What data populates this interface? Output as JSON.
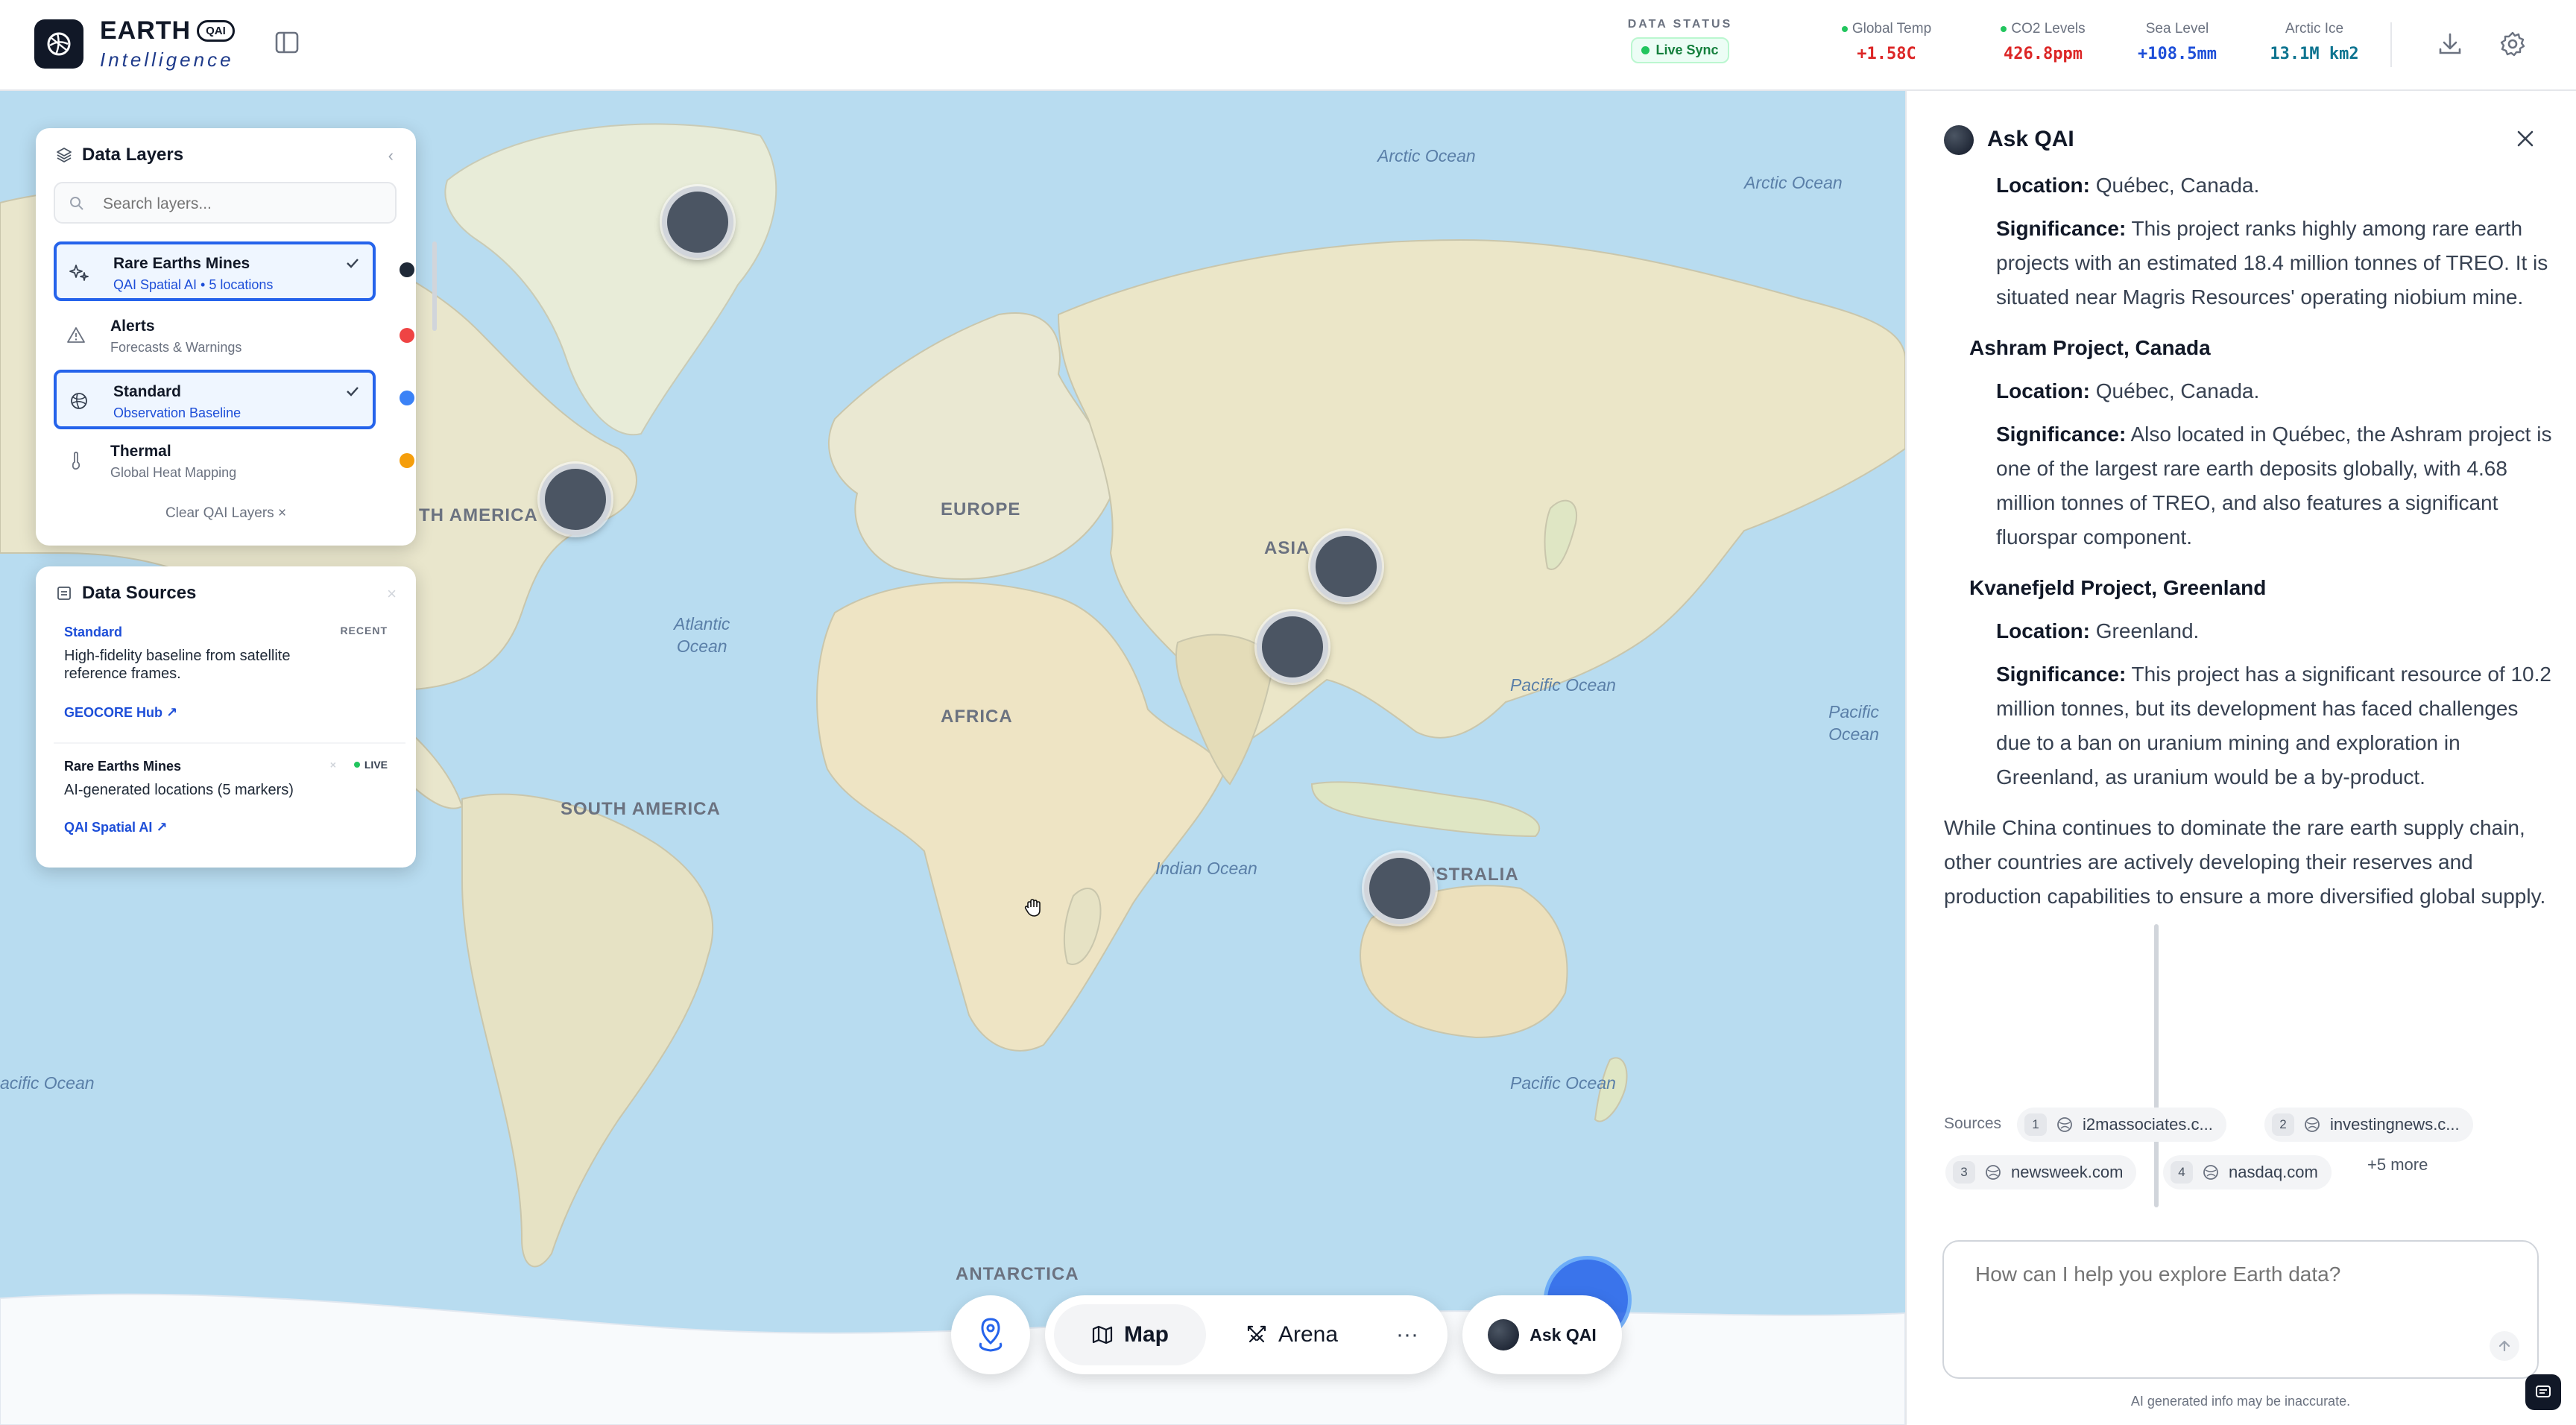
{
  "brand": {
    "name": "EARTH",
    "badge": "QAI",
    "subtitle": "Intelligence"
  },
  "header": {
    "data_status_label": "DATA STATUS",
    "live_sync": "Live Sync",
    "metrics": [
      {
        "label": "Global Temp",
        "value": "+1.58C",
        "color": "#dc2626",
        "has_dot": true
      },
      {
        "label": "CO2 Levels",
        "value": "426.8ppm",
        "color": "#dc2626",
        "has_dot": true
      },
      {
        "label": "Sea Level",
        "value": "+108.5mm",
        "color": "#1d4ed8",
        "has_dot": false
      },
      {
        "label": "Arctic Ice",
        "value": "13.1M km2",
        "color": "#0e7490",
        "has_dot": false
      }
    ]
  },
  "map": {
    "labels": {
      "north_america": "TH AMERICA",
      "europe": "EUROPE",
      "asia": "ASIA",
      "africa": "AFRICA",
      "south_america": "SOUTH AMERICA",
      "australia": "AUSTRALIA",
      "antarctica": "ANTARCTICA"
    },
    "oceans": {
      "arctic_1": "Arctic Ocean",
      "arctic_2": "Arctic Ocean",
      "atlantic_1": "Atlantic",
      "atlantic_2": "Ocean",
      "pacific_1": "Pacific Ocean",
      "pacific_2": "Pacific Ocean",
      "indian": "Indian Ocean",
      "pacific_3": "Pacific Ocean",
      "pacific_4": "acific Ocean"
    }
  },
  "layers_panel": {
    "title": "Data Layers",
    "search_placeholder": "Search layers...",
    "clear_label": "Clear QAI Layers",
    "items": [
      {
        "name": "Rare Earths Mines",
        "sub": "QAI Spatial AI • 5 locations",
        "selected": true,
        "dot": "#1f2937"
      },
      {
        "name": "Alerts",
        "sub": "Forecasts & Warnings",
        "selected": false,
        "dot": "#ef4444"
      },
      {
        "name": "Standard",
        "sub": "Observation Baseline",
        "selected": true,
        "dot": "#3b82f6"
      },
      {
        "name": "Thermal",
        "sub": "Global Heat Mapping",
        "selected": false,
        "dot": "#f59e0b"
      }
    ]
  },
  "sources_panel": {
    "title": "Data Sources",
    "cards": [
      {
        "name": "Standard",
        "tag": "RECENT",
        "desc": "High-fidelity baseline from satellite reference frames.",
        "link": "GEOCORE Hub"
      },
      {
        "name": "Rare Earths Mines",
        "tag": "LIVE",
        "desc": "AI-generated locations (5 markers)",
        "link": "QAI Spatial AI"
      }
    ]
  },
  "toolbar": {
    "map": "Map",
    "arena": "Arena",
    "more": "···",
    "ask": "Ask QAI"
  },
  "chat": {
    "title": "Ask QAI",
    "location_label": "Location:",
    "significance_label": "Significance:",
    "p1_location": "Québec, Canada.",
    "p1_significance": "This project ranks highly among rare earth projects with an estimated 18.4 million tonnes of TREO. It is situated near Magris Resources' operating niobium mine.",
    "h2": "Ashram Project, Canada",
    "p2_location": "Québec, Canada.",
    "p2_significance": "Also located in Québec, the Ashram project is one of the largest rare earth deposits globally, with 4.68 million tonnes of TREO, and also features a significant fluorspar component.",
    "h3": "Kvanefjeld Project, Greenland",
    "p3_location": "Greenland.",
    "p3_significance": "This project has a significant resource of 10.2 million tonnes, but its development has faced challenges due to a ban on uranium mining and exploration in Greenland, as uranium would be a by-product.",
    "summary": "While China continues to dominate the rare earth supply chain, other countries are actively developing their reserves and production capabilities to ensure a more diversified global supply.",
    "sources_label": "Sources",
    "sources": [
      {
        "n": "1",
        "site": "i2massociates.c..."
      },
      {
        "n": "2",
        "site": "investingnews.c..."
      },
      {
        "n": "3",
        "site": "newsweek.com"
      },
      {
        "n": "4",
        "site": "nasdaq.com"
      }
    ],
    "more_sources": "+5 more",
    "input_placeholder": "How can I help you explore Earth data?",
    "disclaimer": "AI generated info may be inaccurate."
  }
}
